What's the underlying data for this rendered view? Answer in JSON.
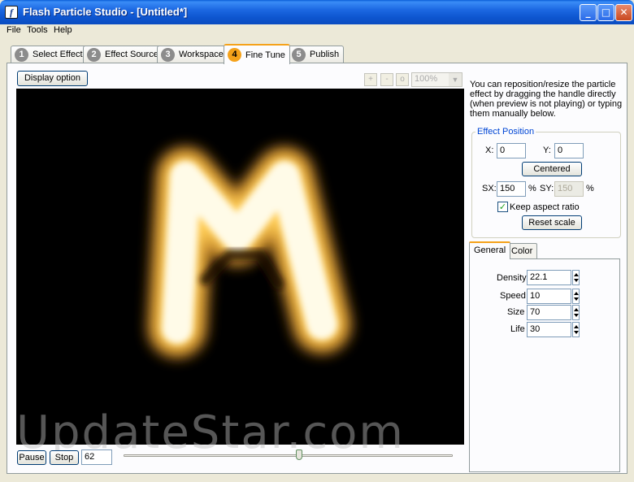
{
  "window": {
    "title": "Flash Particle Studio - [Untitled*]",
    "app_icon_glyph": "f",
    "min_glyph": "_",
    "max_glyph": "□",
    "close_glyph": "✕"
  },
  "menu": [
    "File",
    "Tools",
    "Help"
  ],
  "tabs": [
    {
      "num": "1",
      "label": "Select Effect"
    },
    {
      "num": "2",
      "label": "Effect Source"
    },
    {
      "num": "3",
      "label": "Workspace"
    },
    {
      "num": "4",
      "label": "Fine Tune"
    },
    {
      "num": "5",
      "label": "Publish"
    }
  ],
  "active_tab": "Fine Tune",
  "toolbar": {
    "display_option": "Display option",
    "zoom_in": "+",
    "zoom_out": "-",
    "zoom_reset": "o",
    "zoom_value": "100%",
    "dropdown_arrow": "▼"
  },
  "preview": {
    "letter": "M",
    "watermark": "UpdateStar.com"
  },
  "info_text": "You can reposition/resize the particle effect by dragging the handle directly (when preview is not playing) or typing them manually below.",
  "effect_position": {
    "title": "Effect Position",
    "x_label": "X:",
    "x_value": "0",
    "y_label": "Y:",
    "y_value": "0",
    "centered": "Centered",
    "sx_label": "SX:",
    "sx_value": "150",
    "sx_unit": "%",
    "sy_label": "SY:",
    "sy_value": "150",
    "sy_unit": "%",
    "check_glyph": "✓",
    "keep_aspect": "Keep aspect ratio",
    "reset_scale": "Reset scale"
  },
  "subtabs": [
    "General",
    "Color"
  ],
  "general": {
    "fields": [
      {
        "label": "Density",
        "value": "22.1"
      },
      {
        "label": "Speed",
        "value": "10"
      },
      {
        "label": "Size",
        "value": "70"
      },
      {
        "label": "Life",
        "value": "30"
      }
    ]
  },
  "playback": {
    "pause": "Pause",
    "stop": "Stop",
    "frame": "62"
  },
  "colors": {
    "titlebar": "#0a4cc0",
    "active_tab_accent": "#f5a21a",
    "group_title": "#0046d5",
    "glow": "#ffcc55"
  }
}
